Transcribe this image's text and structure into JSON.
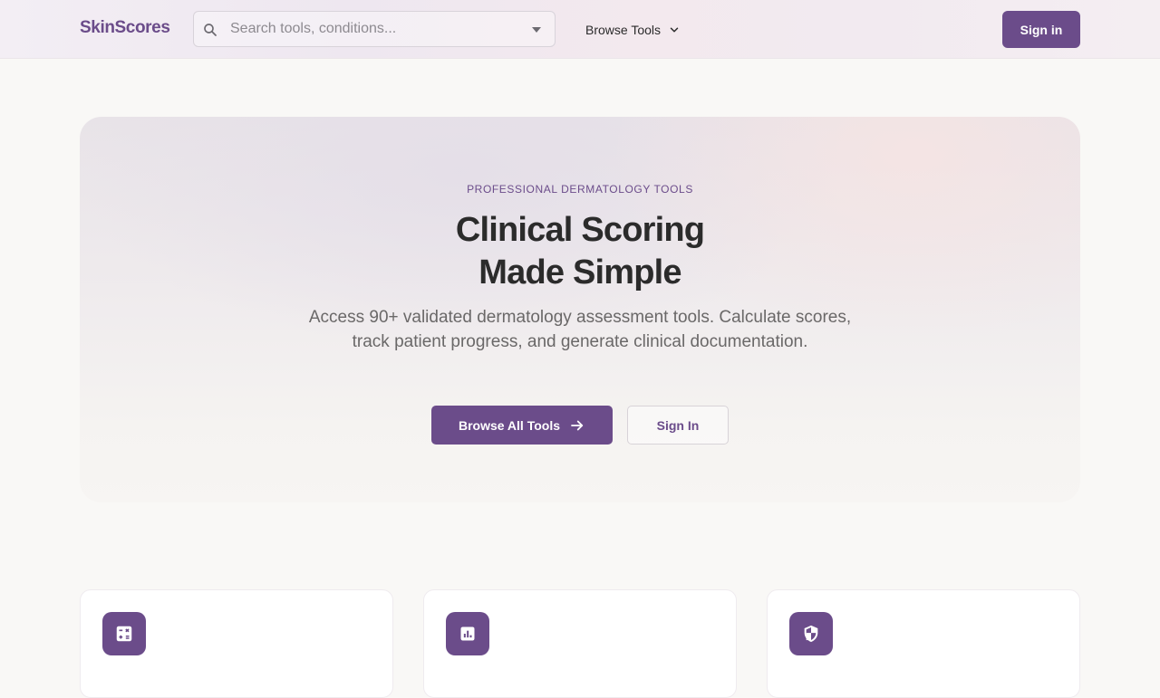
{
  "header": {
    "logo": "SkinScores",
    "search": {
      "placeholder": "Search tools, conditions...",
      "value": ""
    },
    "browse_label": "Browse Tools",
    "signin_label": "Sign in"
  },
  "hero": {
    "eyebrow": "PROFESSIONAL DERMATOLOGY TOOLS",
    "title_line1": "Clinical Scoring",
    "title_line2": "Made Simple",
    "subtitle": "Access 90+ validated dermatology assessment tools. Calculate scores, track patient progress, and generate clinical documentation.",
    "primary_cta": "Browse All Tools",
    "secondary_cta": "Sign In"
  },
  "features": {
    "cards": [
      {
        "icon": "calculator-icon"
      },
      {
        "icon": "bar-chart-icon"
      },
      {
        "icon": "shield-icon"
      }
    ]
  },
  "colors": {
    "brand": "#6b4c8a",
    "background": "#f9f8f6",
    "text": "#2b2b2b",
    "muted_text": "#6a6868"
  }
}
